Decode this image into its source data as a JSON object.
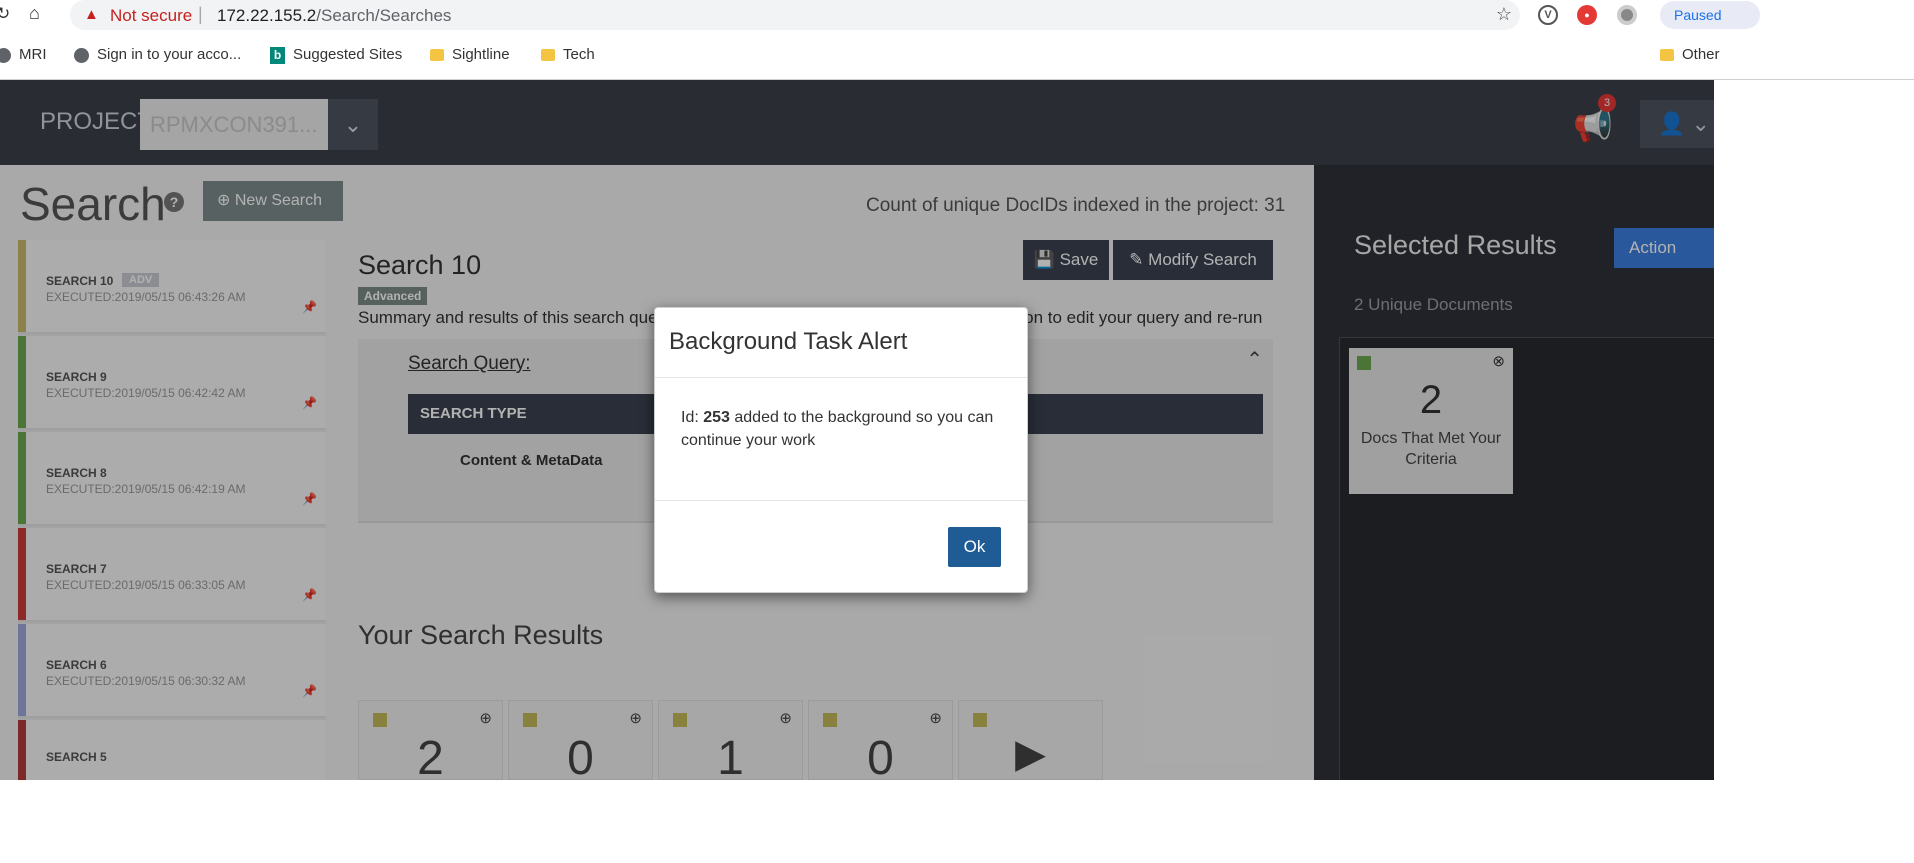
{
  "browser": {
    "security_label": "Not secure",
    "url_host": "172.22.155.2",
    "url_path": "/Search/Searches",
    "profile_label": "Paused",
    "bookmarks": [
      {
        "label": "MRI"
      },
      {
        "label": "Sign in to your acco..."
      },
      {
        "label": "Suggested Sites"
      },
      {
        "label": "Sightline"
      },
      {
        "label": "Tech"
      },
      {
        "label": "Other"
      }
    ]
  },
  "header": {
    "project_label": "PROJECT:",
    "project_value": "RPMXCON391...",
    "notification_count": "3"
  },
  "page": {
    "title": "Search",
    "new_search_label": "New Search",
    "doc_count_text": "Count of unique DocIDs indexed in the project: 31"
  },
  "history": {
    "items": [
      {
        "name": "SEARCH 10",
        "executed": "EXECUTED:2019/05/15 06:43:26 AM",
        "badge": "ADV",
        "color": "#c8b96a"
      },
      {
        "name": "SEARCH 9",
        "executed": "EXECUTED:2019/05/15 06:42:42 AM",
        "color": "#6aa84f"
      },
      {
        "name": "SEARCH 8",
        "executed": "EXECUTED:2019/05/15 06:42:19 AM",
        "color": "#6aa84f"
      },
      {
        "name": "SEARCH 7",
        "executed": "EXECUTED:2019/05/15 06:33:05 AM",
        "color": "#cc3b3b"
      },
      {
        "name": "SEARCH 6",
        "executed": "EXECUTED:2019/05/15 06:30:32 AM",
        "color": "#9fa8da"
      },
      {
        "name": "SEARCH 5",
        "executed": "",
        "color": "#b33b3b"
      }
    ]
  },
  "search": {
    "title": "Search 10",
    "type_badge": "Advanced",
    "save_label": "Save",
    "modify_label": "Modify Search",
    "summary": "Summary and results of this search query are shown below. Click the Modify Search button to edit your query and re-run",
    "query_heading": "Search Query:",
    "table_header": "SEARCH TYPE",
    "table_value": "Content & MetaData",
    "results_title": "Your Search Results",
    "result_counts": [
      "2",
      "0",
      "1",
      "0",
      ""
    ]
  },
  "selected": {
    "title": "Selected Results",
    "action_label": "Action",
    "unique_docs": "2 Unique Documents",
    "card_count": "2",
    "card_caption": "Docs That Met Your Criteria"
  },
  "modal": {
    "title": "Background Task Alert",
    "body_prefix": "Id: ",
    "task_id": "253",
    "body_suffix": " added to the background so you can continue your work",
    "ok_label": "Ok"
  }
}
